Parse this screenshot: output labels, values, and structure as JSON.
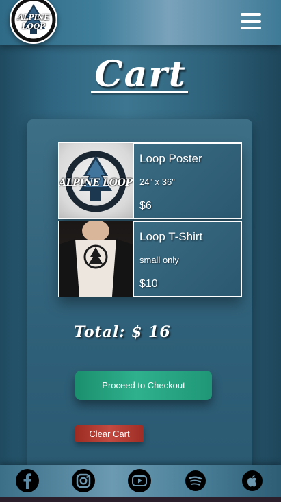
{
  "header": {
    "logo_text": "ALPINE LOOP",
    "menu_icon": "hamburger-menu-icon"
  },
  "page": {
    "title": "Cart"
  },
  "cart": {
    "items": [
      {
        "name": "Loop Poster",
        "detail": "24\" x 36\"",
        "price": "$6",
        "image": "alpine-loop-poster",
        "image_text": "ALPINE LOOP"
      },
      {
        "name": "Loop T-Shirt",
        "detail": "small only",
        "price": "$10",
        "image": "alpine-loop-tshirt"
      }
    ],
    "total_label": "Total: $ 16",
    "checkout_label": "Proceed to Checkout",
    "clear_label": "Clear Cart"
  },
  "footer": {
    "social": [
      "facebook-icon",
      "instagram-icon",
      "youtube-icon",
      "spotify-icon",
      "apple-music-icon"
    ]
  },
  "colors": {
    "checkout_button": "#2fb18d",
    "clear_button": "#c24a40",
    "background": "#2f6580"
  }
}
